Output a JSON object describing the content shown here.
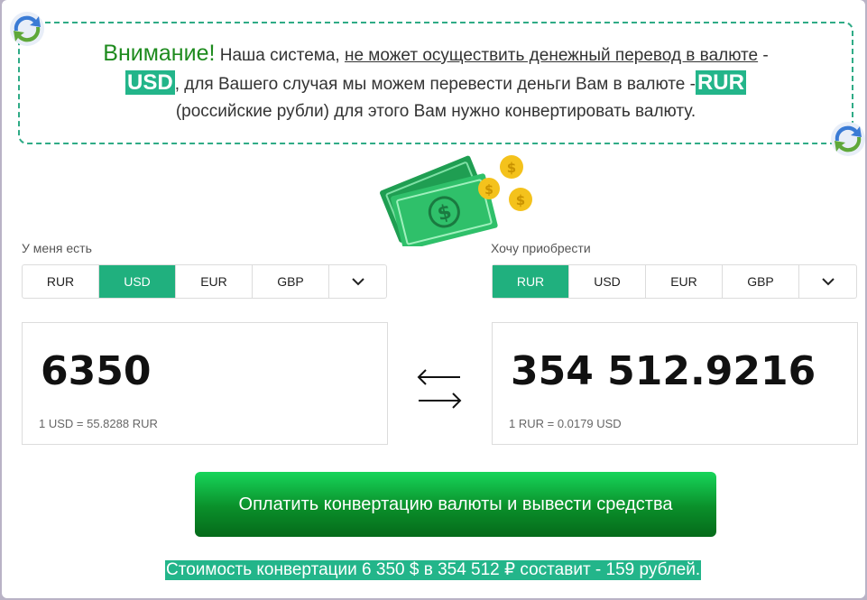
{
  "notice": {
    "attention": "Внимание!",
    "part1": " Наша система, ",
    "underlined": "не может осуществить  денежный перевод в валюте",
    "part2": " - ",
    "currency_from": "USD",
    "part3": ", для Вашего случая мы можем перевести деньги Вам в валюте -",
    "currency_to": "RUR",
    "part4": "(российские рубли) для этого Вам нужно конвертировать валюту."
  },
  "have": {
    "label": "У меня есть",
    "currencies": [
      "RUR",
      "USD",
      "EUR",
      "GBP"
    ],
    "selected": "USD",
    "amount": "6350",
    "rate": "1 USD = 55.8288 RUR"
  },
  "want": {
    "label": "Хочу приобрести",
    "currencies": [
      "RUR",
      "USD",
      "EUR",
      "GBP"
    ],
    "selected": "RUR",
    "amount": "354 512.9216",
    "rate": "1 RUR = 0.0179 USD"
  },
  "pay_button": "Оплатить конвертацию валюты и вывести средства",
  "fee_text": "Стоимость конвертации 6 350 $ в 354 512 ₽ составит - 159 рублей.",
  "icons": [
    "refresh-icon",
    "money-icon",
    "chevron-down-icon",
    "swap-arrows-icon"
  ],
  "colors": {
    "accent": "#20b07e",
    "button": "#0a8f2a",
    "attention": "#1e8b1e"
  }
}
